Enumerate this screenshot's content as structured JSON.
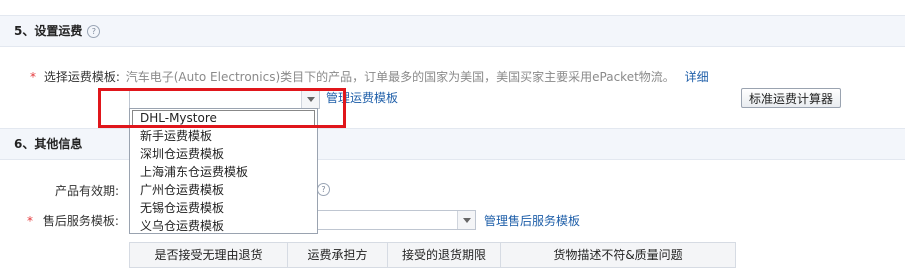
{
  "section5": {
    "title": "5、设置运费",
    "help": "?"
  },
  "shipping": {
    "required_mark": "*",
    "label": "选择运费模板:",
    "hint": "汽车电子(Auto Electronics)类目下的产品，订单最多的国家为美国，美国买家主要采用ePacket物流。",
    "detail_link": "详细",
    "manage_link": "管理运费模板",
    "calculator_button": "标准运费计算器",
    "select_value": "",
    "options": [
      "DHL-Mystore",
      "新手运费模板",
      "深圳仓运费模板",
      "上海浦东仓运费模板",
      "广州仓运费模板",
      "无锡仓运费模板",
      "义乌仓运费模板"
    ],
    "selected_option": "DHL-Mystore"
  },
  "section6": {
    "title": "6、其他信息"
  },
  "other": {
    "validity_label": "产品有效期:",
    "validity_help": "?",
    "aftersale_required_mark": "*",
    "aftersale_label": "售后服务模板:",
    "aftersale_value": "",
    "aftersale_manage_link": "管理售后服务模板"
  },
  "aftersale_table": {
    "headers": [
      "是否接受无理由退货",
      "运费承担方",
      "接受的退货期限",
      "货物描述不符&质量问题"
    ]
  },
  "colors": {
    "highlight_frame": "#e0161b",
    "link": "#1f5fa9",
    "required": "#e4393c"
  }
}
